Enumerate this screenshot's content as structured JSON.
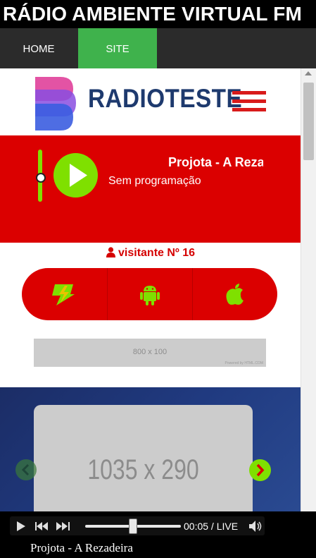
{
  "app": {
    "title": "RÁDIO AMBIENTE VIRTUAL FM"
  },
  "nav": {
    "items": [
      {
        "label": "HOME"
      },
      {
        "label": "SITE",
        "active": true
      }
    ]
  },
  "site": {
    "logo_text": "RADIOTESTE",
    "player": {
      "now_playing": "Projota - A Rezadeira",
      "program": "Sem programação",
      "dashes": "- - - - - - -"
    },
    "visitor": {
      "text": "visitante Nº 16"
    },
    "apps": [
      {
        "icon": "winamp-icon"
      },
      {
        "icon": "android-icon"
      },
      {
        "icon": "apple-icon"
      }
    ],
    "banner": {
      "text": "800 x 100",
      "credit": "Powered by HTML.COM"
    },
    "carousel": {
      "slide_text": "1035 x 290"
    }
  },
  "audio": {
    "time": "00:05 / LIVE",
    "progress": 0.5,
    "track_title": "Projota - A Rezadeira"
  },
  "colors": {
    "brand_red": "#db0000",
    "accent_green": "#7fe000",
    "nav_active": "#3fb24c",
    "logo_blue": "#1e3a6e"
  }
}
